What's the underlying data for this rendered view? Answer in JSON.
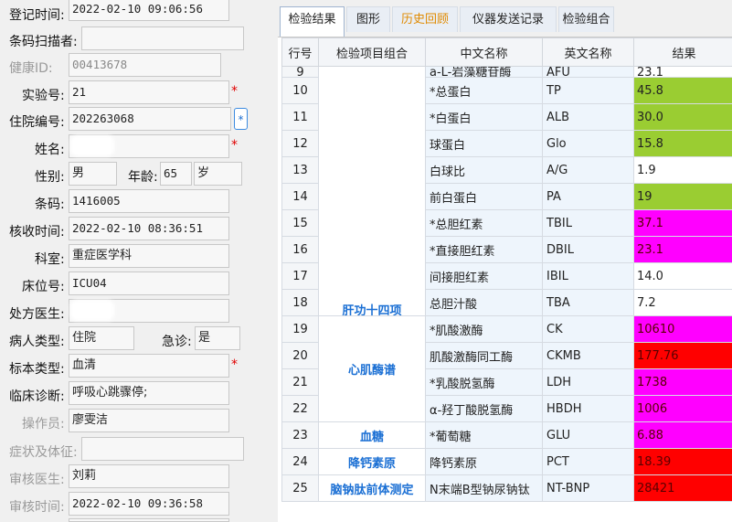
{
  "form": {
    "reg_time": {
      "label": "登记时间:",
      "value": "2022-02-10 09:06:56"
    },
    "barcode_scanner": {
      "label": "条码扫描者:",
      "value": ""
    },
    "health_id": {
      "label": "健康ID:",
      "value": "00413678"
    },
    "exam_no": {
      "label": "实验号:",
      "value": "21",
      "required": "*"
    },
    "inpatient_no": {
      "label": "住院编号:",
      "value": "202263068",
      "button": "*"
    },
    "name": {
      "label": "姓名:",
      "value": "",
      "required": "*"
    },
    "gender": {
      "label": "性别:",
      "value": "男"
    },
    "age": {
      "label": "年龄:",
      "value": "65",
      "unit": "岁"
    },
    "barcode": {
      "label": "条码:",
      "value": "1416005"
    },
    "receive_time": {
      "label": "核收时间:",
      "value": "2022-02-10 08:36:51"
    },
    "department": {
      "label": "科室:",
      "value": "重症医学科"
    },
    "bed_no": {
      "label": "床位号:",
      "value": "ICU04"
    },
    "prescribing_doctor": {
      "label": "处方医生:",
      "value": ""
    },
    "patient_type": {
      "label": "病人类型:",
      "value": "住院"
    },
    "emergency": {
      "label": "急诊:",
      "value": "是"
    },
    "specimen_type": {
      "label": "标本类型:",
      "value": "血清",
      "required": "*"
    },
    "clinical_diagnosis": {
      "label": "临床诊断:",
      "value": "呼吸心跳骤停;"
    },
    "operator": {
      "label": "操作员:",
      "value": "廖雯洁"
    },
    "symptoms": {
      "label": "症状及体征:",
      "value": ""
    },
    "reviewer": {
      "label": "审核医生:",
      "value": "刘莉"
    },
    "review_time": {
      "label": "审核时间:",
      "value": "2022-02-10 09:36:58"
    }
  },
  "tabs": [
    {
      "label": "检验结果",
      "active": true
    },
    {
      "label": "图形"
    },
    {
      "label": "历史回顾",
      "orange": true
    },
    {
      "label": "仪器发送记录"
    },
    {
      "label": "检验组合"
    }
  ],
  "table": {
    "headers": [
      "行号",
      "检验项目组合",
      "中文名称",
      "英文名称",
      "结果"
    ],
    "groups": [
      {
        "name": "肝功十四项",
        "rows": 10
      },
      {
        "name": "心肌酶谱",
        "rows": 4
      },
      {
        "name": "血糖",
        "rows": 1
      },
      {
        "name": "降钙素原",
        "rows": 1
      },
      {
        "name": "脑钠肽前体测定",
        "rows": 1
      }
    ],
    "rows": [
      {
        "no": "9",
        "cn": "a-L-岩藻糖苷酶",
        "en": "AFU",
        "result": "23.1",
        "color": "#ffffff"
      },
      {
        "no": "10",
        "cn": "*总蛋白",
        "en": "TP",
        "result": "45.8",
        "color": "#9acd32"
      },
      {
        "no": "11",
        "cn": "*白蛋白",
        "en": "ALB",
        "result": "30.0",
        "color": "#9acd32"
      },
      {
        "no": "12",
        "cn": "球蛋白",
        "en": "Glo",
        "result": "15.8",
        "color": "#9acd32"
      },
      {
        "no": "13",
        "cn": "白球比",
        "en": "A/G",
        "result": "1.9",
        "color": "#ffffff"
      },
      {
        "no": "14",
        "cn": "前白蛋白",
        "en": "PA",
        "result": "19",
        "color": "#9acd32"
      },
      {
        "no": "15",
        "cn": "*总胆红素",
        "en": "TBIL",
        "result": "37.1",
        "color": "#ff00ff"
      },
      {
        "no": "16",
        "cn": "*直接胆红素",
        "en": "DBIL",
        "result": "23.1",
        "color": "#ff00ff"
      },
      {
        "no": "17",
        "cn": "间接胆红素",
        "en": "IBIL",
        "result": "14.0",
        "color": "#ffffff"
      },
      {
        "no": "18",
        "cn": "总胆汁酸",
        "en": "TBA",
        "result": "7.2",
        "color": "#ffffff"
      },
      {
        "no": "19",
        "cn": "*肌酸激酶",
        "en": "CK",
        "result": "10610",
        "color": "#ff00ff"
      },
      {
        "no": "20",
        "cn": "肌酸激酶同工酶",
        "en": "CKMB",
        "result": "177.76",
        "color": "#ff0000"
      },
      {
        "no": "21",
        "cn": "*乳酸脱氢酶",
        "en": "LDH",
        "result": "1738",
        "color": "#ff00ff"
      },
      {
        "no": "22",
        "cn": "α-羟丁酸脱氢酶",
        "en": "HBDH",
        "result": "1006",
        "color": "#ff00ff"
      },
      {
        "no": "23",
        "cn": "*葡萄糖",
        "en": "GLU",
        "result": "6.88",
        "color": "#ff00ff"
      },
      {
        "no": "24",
        "cn": "降钙素原",
        "en": "PCT",
        "result": "18.39",
        "color": "#ff0000"
      },
      {
        "no": "25",
        "cn": "N末端B型钠尿钠钛",
        "en": "NT-BNP",
        "result": "28421",
        "color": "#ff0000"
      }
    ]
  }
}
